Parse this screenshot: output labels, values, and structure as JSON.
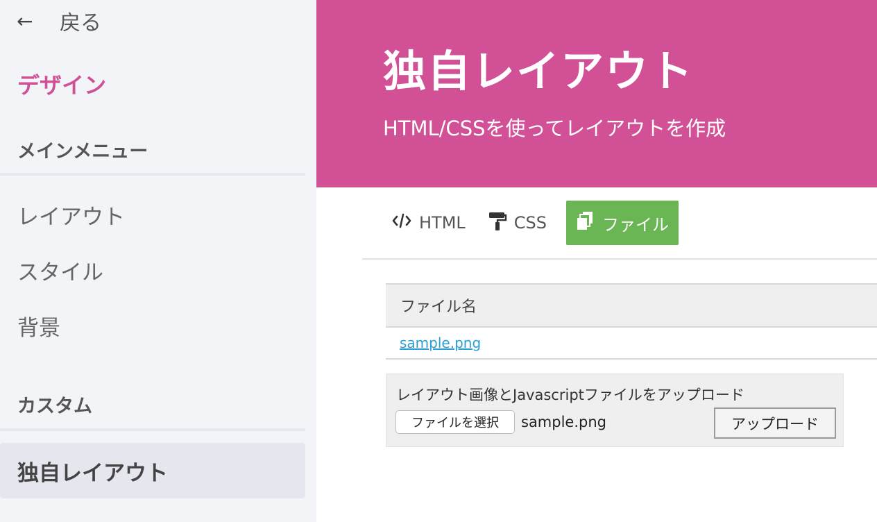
{
  "sidebar": {
    "back_label": "戻る",
    "section_title": "デザイン",
    "groups": [
      {
        "label": "メインメニュー",
        "items": [
          {
            "label": "レイアウト"
          },
          {
            "label": "スタイル"
          },
          {
            "label": "背景"
          }
        ]
      },
      {
        "label": "カスタム",
        "items": [
          {
            "label": "独自レイアウト",
            "active": true
          }
        ]
      }
    ]
  },
  "header": {
    "title": "独自レイアウト",
    "subtitle": "HTML/CSSを使ってレイアウトを作成",
    "color": "#d25196"
  },
  "tabs": [
    {
      "label": "HTML",
      "icon": "code-icon"
    },
    {
      "label": "CSS",
      "icon": "paint-roller-icon"
    },
    {
      "label": "ファイル",
      "icon": "files-icon",
      "active": true
    }
  ],
  "accent_color": "#6ab554",
  "file_table": {
    "header": "ファイル名",
    "rows": [
      {
        "name": "sample.png"
      }
    ]
  },
  "upload": {
    "label": "レイアウト画像とJavascriptファイルをアップロード",
    "choose_button": "ファイルを選択",
    "selected_file": "sample.png",
    "submit_button": "アップロード"
  }
}
